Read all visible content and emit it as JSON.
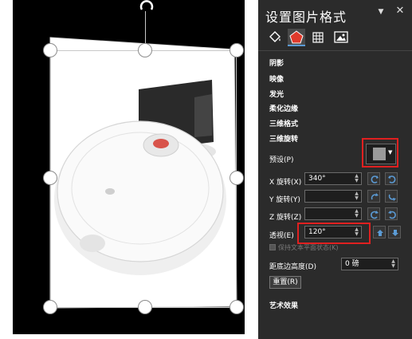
{
  "panel": {
    "title": "设置图片格式",
    "pin_icon": "pin-dropdown-icon",
    "close_icon": "close-icon",
    "tabs": [
      {
        "name": "fill-line",
        "icon": "paint-bucket-icon"
      },
      {
        "name": "effects",
        "icon": "pentagon-icon",
        "selected": true
      },
      {
        "name": "size-properties",
        "icon": "size-layout-icon"
      },
      {
        "name": "picture",
        "icon": "picture-icon"
      }
    ]
  },
  "sections": {
    "shadow": "阴影",
    "reflection": "映像",
    "glow": "发光",
    "soft_edges": "柔化边缘",
    "format_3d": "三维格式",
    "rotation_3d": "三维旋转",
    "artistic": "艺术效果"
  },
  "rotation3d": {
    "preset_label": "预设(P)",
    "x_label": "X 旋转(X)",
    "x_value": "340°",
    "y_label": "Y 旋转(Y)",
    "y_value": "",
    "z_label": "Z 旋转(Z)",
    "z_value": "",
    "perspective_label": "透视(E)",
    "perspective_value": "120°",
    "keep_flat_label": "保持文本平面状态(K)",
    "distance_label": "距底边高度(D)",
    "distance_value": "0 磅",
    "reset_label": "重置(R)"
  },
  "colors": {
    "panel_bg": "#2b2b2b",
    "highlight": "#e02020",
    "selected_tab_accent": "#5b9bd5"
  }
}
